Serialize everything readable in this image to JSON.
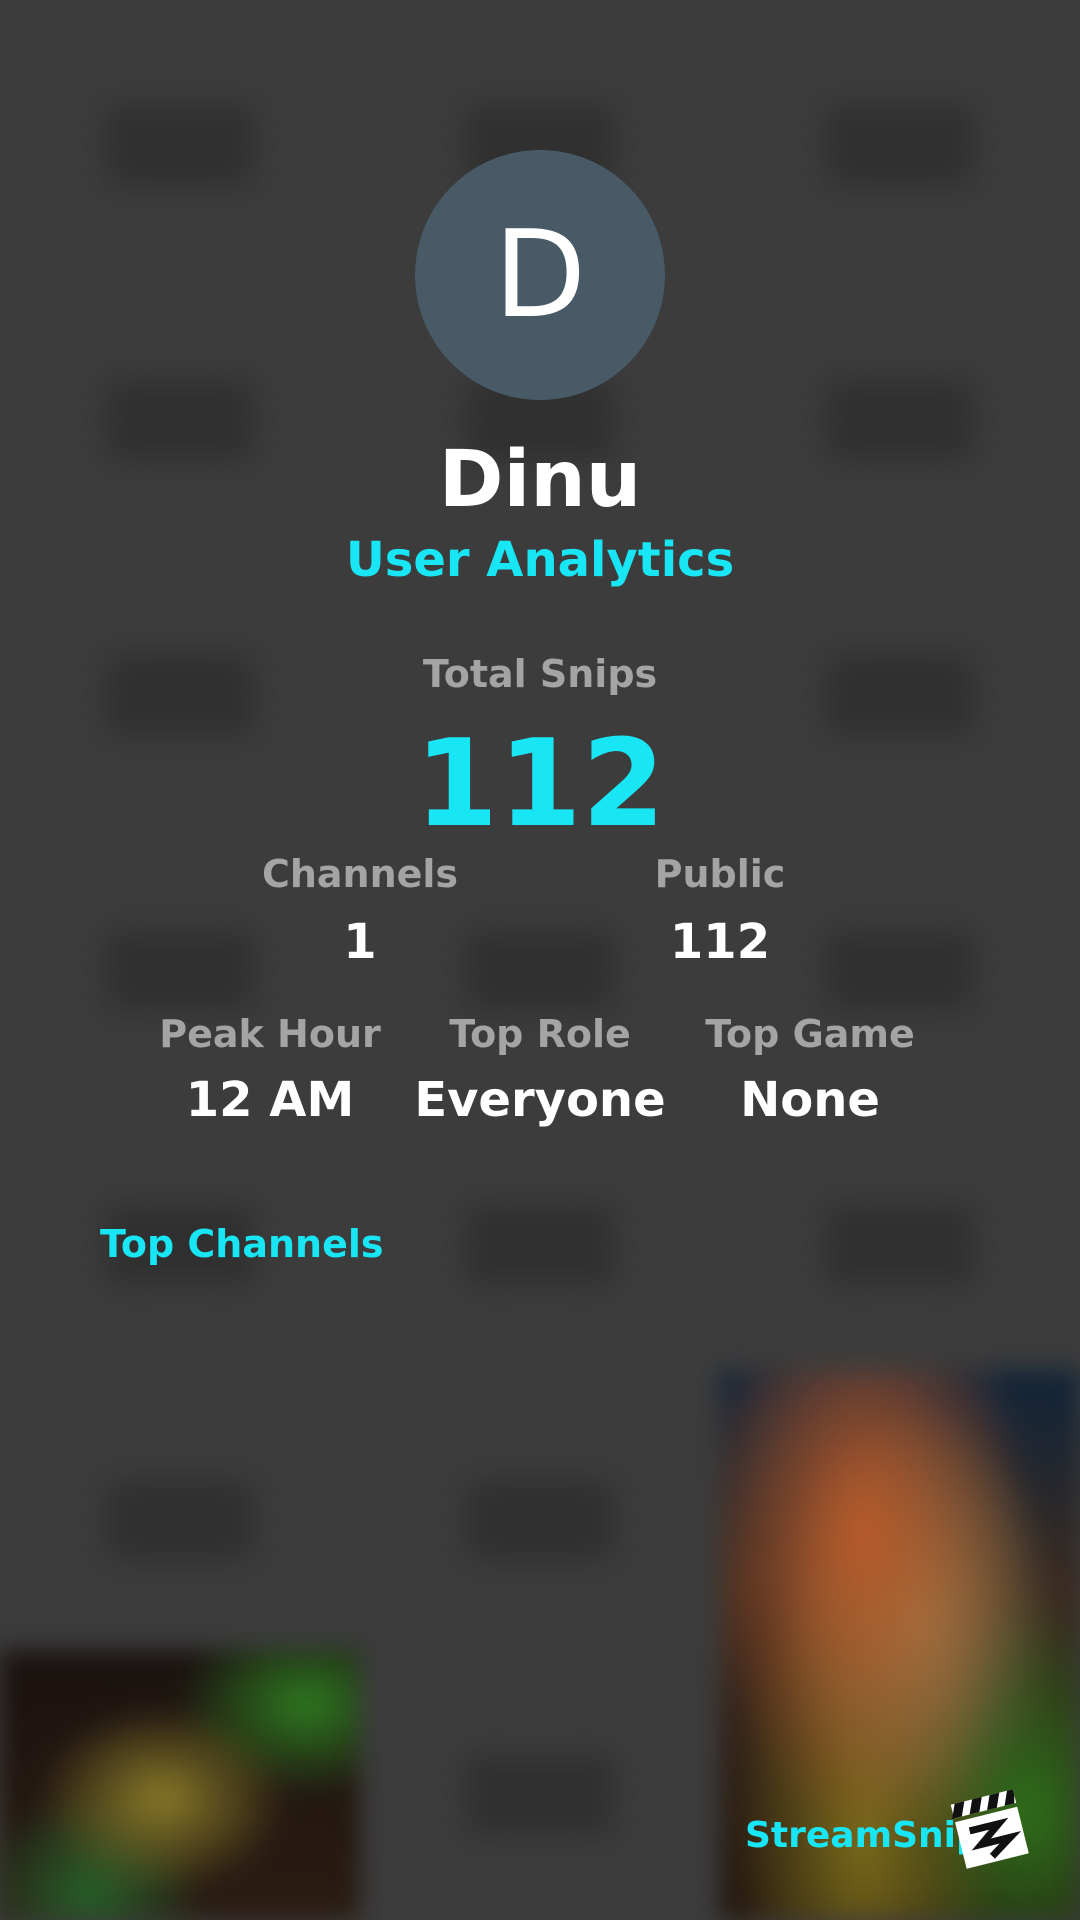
{
  "profile": {
    "avatar_initial": "D",
    "username": "Dinu",
    "subtitle": "User Analytics"
  },
  "totals": {
    "label": "Total Snips",
    "value": "112"
  },
  "stats_row1": {
    "channels": {
      "label": "Channels",
      "value": "1"
    },
    "public": {
      "label": "Public",
      "value": "112"
    }
  },
  "stats_row2": {
    "peak_hour": {
      "label": "Peak Hour",
      "value": "12 AM"
    },
    "top_role": {
      "label": "Top Role",
      "value": "Everyone"
    },
    "top_game": {
      "label": "Top Game",
      "value": "None"
    }
  },
  "sections": {
    "top_channels_title": "Top Channels"
  },
  "brand": {
    "name": "StreamSnip",
    "logo_icon": "clapperboard-icon"
  },
  "colors": {
    "accent": "#18e6f5",
    "background": "#3c3c3c",
    "avatar_bg": "#475a66",
    "label": "#a4a4a4"
  }
}
